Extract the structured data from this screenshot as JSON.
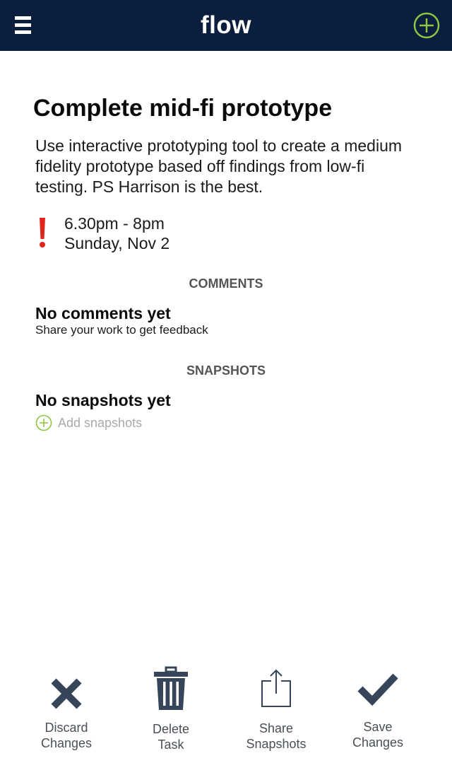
{
  "header": {
    "title": "flow",
    "menu_icon": "hamburger-menu-icon",
    "add_icon": "plus-circle-icon"
  },
  "task": {
    "title": "Complete mid-fi prototype",
    "description": "Use interactive prototyping tool to create a medium fidelity prototype based off findings from low-fi testing. PS Harrison is the best.",
    "priority_icon": "exclamation-icon",
    "time": "6.30pm - 8pm",
    "date": "Sunday, Nov 2"
  },
  "comments": {
    "heading": "COMMENTS",
    "empty_title": "No comments yet",
    "empty_subtitle": "Share your work to get feedback"
  },
  "snapshots": {
    "heading": "SNAPSHOTS",
    "empty_title": "No snapshots yet",
    "add_label": "Add snapshots",
    "add_icon": "plus-circle-icon"
  },
  "actions": [
    {
      "line1": "Discard",
      "line2": "Changes",
      "icon": "x-icon"
    },
    {
      "line1": "Delete",
      "line2": "Task",
      "icon": "trash-icon"
    },
    {
      "line1": "Share",
      "line2": "Snapshots",
      "icon": "share-icon"
    },
    {
      "line1": "Save",
      "line2": "Changes",
      "icon": "checkmark-icon"
    }
  ],
  "colors": {
    "header_bg": "#0b1e3d",
    "accent_green": "#8dc63f",
    "priority_red": "#e0261b",
    "action_icon": "#36455a",
    "muted_text": "#a9a9a9"
  }
}
